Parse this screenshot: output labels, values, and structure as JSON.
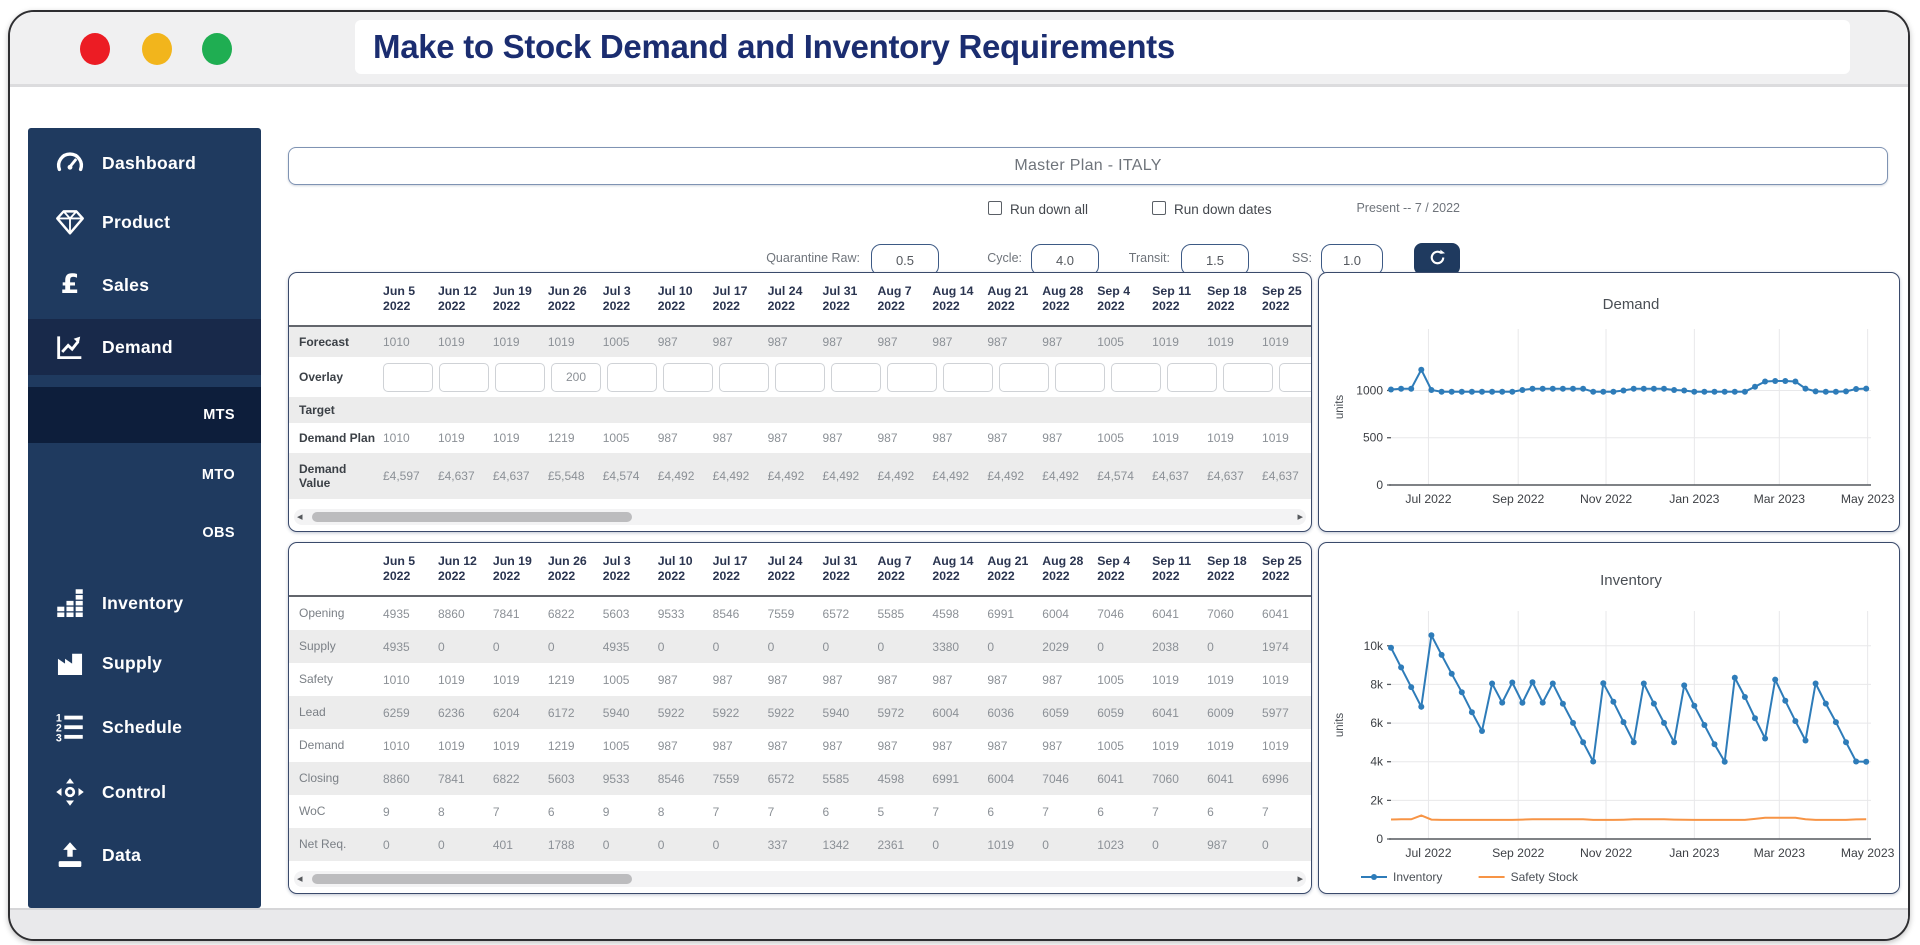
{
  "window": {
    "title": "Make to Stock Demand and Inventory Requirements"
  },
  "titlebar_buttons": [
    "close",
    "minimize",
    "maximize"
  ],
  "sidebar": {
    "items": [
      {
        "label": "Dashboard",
        "icon": "gauge-icon"
      },
      {
        "label": "Product",
        "icon": "gem-icon"
      },
      {
        "label": "Sales",
        "icon": "pound-icon"
      },
      {
        "label": "Demand",
        "icon": "trend-icon",
        "active": true
      },
      {
        "label": "Inventory",
        "icon": "stock-bars-icon"
      },
      {
        "label": "Supply",
        "icon": "factory-icon"
      },
      {
        "label": "Schedule",
        "icon": "numbered-list-icon"
      },
      {
        "label": "Control",
        "icon": "move-icon"
      },
      {
        "label": "Data",
        "icon": "upload-icon"
      }
    ],
    "subitems": [
      {
        "label": "MTS",
        "active": true
      },
      {
        "label": "MTO",
        "active": false
      },
      {
        "label": "OBS",
        "active": false
      }
    ],
    "colors": {
      "bg": "#1f3a5f",
      "active_item": "#18294a",
      "active_sub": "#0d1e3b"
    }
  },
  "header": {
    "title": "Master Plan - ITALY"
  },
  "controls": {
    "run_down_all": "Run down all",
    "run_down_dates": "Run down dates",
    "present": "Present -- 7 / 2022",
    "params": [
      {
        "label": "Quarantine Raw:",
        "value": "0.5"
      },
      {
        "label": "Cycle:",
        "value": "4.0"
      },
      {
        "label": "Transit:",
        "value": "1.5"
      },
      {
        "label": "SS:",
        "value": "1.0"
      }
    ],
    "refresh_icon": "refresh-icon"
  },
  "demand_table": {
    "columns": [
      [
        "Jun 5",
        "2022"
      ],
      [
        "Jun 12",
        "2022"
      ],
      [
        "Jun 19",
        "2022"
      ],
      [
        "Jun 26",
        "2022"
      ],
      [
        "Jul 3",
        "2022"
      ],
      [
        "Jul 10",
        "2022"
      ],
      [
        "Jul 17",
        "2022"
      ],
      [
        "Jul 24",
        "2022"
      ],
      [
        "Jul 31",
        "2022"
      ],
      [
        "Aug 7",
        "2022"
      ],
      [
        "Aug 14",
        "2022"
      ],
      [
        "Aug 21",
        "2022"
      ],
      [
        "Aug 28",
        "2022"
      ],
      [
        "Sep 4",
        "2022"
      ],
      [
        "Sep 11",
        "2022"
      ],
      [
        "Sep 18",
        "2022"
      ],
      [
        "Sep 25",
        "2022"
      ]
    ],
    "rows": [
      {
        "label": "Forecast",
        "type": "values",
        "values": [
          "1010",
          "1019",
          "1019",
          "1019",
          "1005",
          "987",
          "987",
          "987",
          "987",
          "987",
          "987",
          "987",
          "987",
          "1005",
          "1019",
          "1019",
          "1019"
        ]
      },
      {
        "label": "Overlay",
        "type": "inputs",
        "values": [
          "",
          "",
          "",
          "200",
          "",
          "",
          "",
          "",
          "",
          "",
          "",
          "",
          "",
          "",
          "",
          "",
          ""
        ]
      },
      {
        "label": "Target",
        "type": "empty",
        "values": []
      },
      {
        "label": "Demand Plan",
        "type": "values",
        "values": [
          "1010",
          "1019",
          "1019",
          "1219",
          "1005",
          "987",
          "987",
          "987",
          "987",
          "987",
          "987",
          "987",
          "987",
          "1005",
          "1019",
          "1019",
          "1019"
        ]
      },
      {
        "label": "Demand Value",
        "type": "values",
        "values": [
          "£4,597",
          "£4,637",
          "£4,637",
          "£5,548",
          "£4,574",
          "£4,492",
          "£4,492",
          "£4,492",
          "£4,492",
          "£4,492",
          "£4,492",
          "£4,492",
          "£4,492",
          "£4,574",
          "£4,637",
          "£4,637",
          "£4,637"
        ]
      }
    ]
  },
  "inventory_table": {
    "columns": [
      [
        "Jun 5",
        "2022"
      ],
      [
        "Jun 12",
        "2022"
      ],
      [
        "Jun 19",
        "2022"
      ],
      [
        "Jun 26",
        "2022"
      ],
      [
        "Jul 3",
        "2022"
      ],
      [
        "Jul 10",
        "2022"
      ],
      [
        "Jul 17",
        "2022"
      ],
      [
        "Jul 24",
        "2022"
      ],
      [
        "Jul 31",
        "2022"
      ],
      [
        "Aug 7",
        "2022"
      ],
      [
        "Aug 14",
        "2022"
      ],
      [
        "Aug 21",
        "2022"
      ],
      [
        "Aug 28",
        "2022"
      ],
      [
        "Sep 4",
        "2022"
      ],
      [
        "Sep 11",
        "2022"
      ],
      [
        "Sep 18",
        "2022"
      ],
      [
        "Sep 25",
        "2022"
      ]
    ],
    "rows": [
      {
        "label": "Opening",
        "type": "values",
        "values": [
          "4935",
          "8860",
          "7841",
          "6822",
          "5603",
          "9533",
          "8546",
          "7559",
          "6572",
          "5585",
          "4598",
          "6991",
          "6004",
          "7046",
          "6041",
          "7060",
          "6041"
        ]
      },
      {
        "label": "Supply",
        "type": "values",
        "values": [
          "4935",
          "0",
          "0",
          "0",
          "4935",
          "0",
          "0",
          "0",
          "0",
          "0",
          "3380",
          "0",
          "2029",
          "0",
          "2038",
          "0",
          "1974"
        ]
      },
      {
        "label": "Safety",
        "type": "values",
        "values": [
          "1010",
          "1019",
          "1019",
          "1219",
          "1005",
          "987",
          "987",
          "987",
          "987",
          "987",
          "987",
          "987",
          "987",
          "1005",
          "1019",
          "1019",
          "1019"
        ]
      },
      {
        "label": "Lead",
        "type": "values",
        "values": [
          "6259",
          "6236",
          "6204",
          "6172",
          "5940",
          "5922",
          "5922",
          "5922",
          "5940",
          "5972",
          "6004",
          "6036",
          "6059",
          "6059",
          "6041",
          "6009",
          "5977"
        ]
      },
      {
        "label": "Demand",
        "type": "values",
        "values": [
          "1010",
          "1019",
          "1019",
          "1219",
          "1005",
          "987",
          "987",
          "987",
          "987",
          "987",
          "987",
          "987",
          "987",
          "1005",
          "1019",
          "1019",
          "1019"
        ]
      },
      {
        "label": "Closing",
        "type": "values",
        "values": [
          "8860",
          "7841",
          "6822",
          "5603",
          "9533",
          "8546",
          "7559",
          "6572",
          "5585",
          "4598",
          "6991",
          "6004",
          "7046",
          "6041",
          "7060",
          "6041",
          "6996"
        ]
      },
      {
        "label": "WoC",
        "type": "values",
        "values": [
          "9",
          "8",
          "7",
          "6",
          "9",
          "8",
          "7",
          "7",
          "6",
          "5",
          "7",
          "6",
          "7",
          "6",
          "7",
          "6",
          "7"
        ]
      },
      {
        "label": "Net Req.",
        "type": "values",
        "values": [
          "0",
          "0",
          "401",
          "1788",
          "0",
          "0",
          "0",
          "337",
          "1342",
          "2361",
          "0",
          "1019",
          "0",
          "1023",
          "0",
          "987",
          "0"
        ]
      }
    ]
  },
  "chart_data": [
    {
      "type": "line",
      "title": "Demand",
      "ylabel": "units",
      "x_ticks": [
        "Jul 2022",
        "Sep 2022",
        "Nov 2022",
        "Jan 2023",
        "Mar 2023",
        "May 2023"
      ],
      "x_tick_fracs": [
        0.078,
        0.265,
        0.448,
        0.632,
        0.809,
        0.993
      ],
      "ylim": [
        0,
        1650
      ],
      "y_ticks": [
        {
          "v": 0,
          "label": "0"
        },
        {
          "v": 500,
          "label": "500"
        },
        {
          "v": 1000,
          "label": "1000"
        }
      ],
      "grid": true,
      "legend": false,
      "series": [
        {
          "name": "Demand",
          "color": "#2e7cb9",
          "markers": true,
          "values": [
            1010,
            1019,
            1019,
            1219,
            1005,
            987,
            987,
            987,
            987,
            987,
            987,
            987,
            987,
            1005,
            1019,
            1019,
            1019,
            1019,
            1019,
            1019,
            987,
            987,
            987,
            1000,
            1019,
            1019,
            1019,
            1019,
            1005,
            1000,
            987,
            987,
            987,
            987,
            987,
            987,
            1040,
            1095,
            1100,
            1100,
            1095,
            1020,
            990,
            987,
            987,
            990,
            1015,
            1020
          ]
        }
      ]
    },
    {
      "type": "line",
      "title": "Inventory",
      "ylabel": "units",
      "x_ticks": [
        "Jul 2022",
        "Sep 2022",
        "Nov 2022",
        "Jan 2023",
        "Mar 2023",
        "May 2023"
      ],
      "x_tick_fracs": [
        0.078,
        0.265,
        0.448,
        0.632,
        0.809,
        0.993
      ],
      "ylim": [
        0,
        11800
      ],
      "y_ticks": [
        {
          "v": 0,
          "label": "0"
        },
        {
          "v": 2000,
          "label": "2k"
        },
        {
          "v": 4000,
          "label": "4k"
        },
        {
          "v": 6000,
          "label": "6k"
        },
        {
          "v": 8000,
          "label": "8k"
        },
        {
          "v": 10000,
          "label": "10k"
        }
      ],
      "grid": true,
      "legend": true,
      "series": [
        {
          "name": "Inventory",
          "color": "#2e7cb9",
          "markers": true,
          "values": [
            9900,
            8880,
            7860,
            6840,
            10540,
            9530,
            8550,
            7600,
            6560,
            5590,
            8050,
            7060,
            8100,
            7050,
            8110,
            7060,
            8050,
            7000,
            6010,
            5010,
            4010,
            8060,
            7100,
            6050,
            5010,
            8050,
            7010,
            6010,
            5010,
            7950,
            6900,
            5900,
            4900,
            4000,
            8350,
            7350,
            6250,
            5200,
            8250,
            7150,
            6100,
            5100,
            8050,
            7010,
            6050,
            5010,
            4010,
            4000
          ]
        },
        {
          "name": "Safety Stock",
          "color": "#f79445",
          "markers": false,
          "values": [
            1010,
            1019,
            1019,
            1219,
            1005,
            987,
            987,
            987,
            987,
            987,
            987,
            987,
            987,
            1005,
            1019,
            1019,
            1019,
            1019,
            1019,
            1019,
            987,
            987,
            987,
            1000,
            1019,
            1019,
            1019,
            1019,
            1005,
            1000,
            987,
            987,
            987,
            987,
            987,
            987,
            1040,
            1095,
            1100,
            1100,
            1095,
            1020,
            990,
            987,
            987,
            990,
            1015,
            1020
          ]
        }
      ]
    }
  ]
}
